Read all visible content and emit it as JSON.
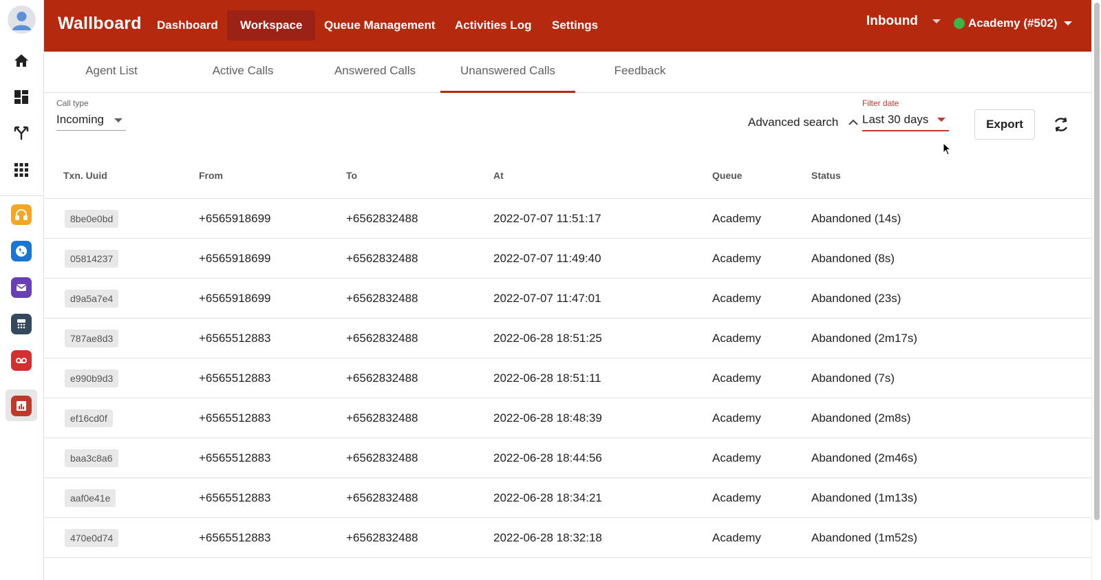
{
  "app": {
    "brand": "Wallboard"
  },
  "nav": [
    {
      "label": "Dashboard"
    },
    {
      "label": "Workspace"
    },
    {
      "label": "Queue Management"
    },
    {
      "label": "Activities Log"
    },
    {
      "label": "Settings"
    }
  ],
  "header": {
    "mode": "Inbound",
    "account": "Academy (#502)",
    "account_status_color": "#3bb54a"
  },
  "tabs": [
    {
      "label": "Agent List"
    },
    {
      "label": "Active Calls"
    },
    {
      "label": "Answered Calls"
    },
    {
      "label": "Unanswered Calls"
    },
    {
      "label": "Feedback"
    }
  ],
  "filters": {
    "call_type_label": "Call type",
    "call_type_value": "Incoming",
    "advanced_search": "Advanced search",
    "filter_date_label": "Filter date",
    "filter_date_value": "Last 30 days",
    "export_label": "Export"
  },
  "table": {
    "headers": [
      "Txn. Uuid",
      "From",
      "To",
      "At",
      "Queue",
      "Status"
    ],
    "rows": [
      [
        "8be0e0bd",
        "+6565918699",
        "+6562832488",
        "2022-07-07 11:51:17",
        "Academy",
        "Abandoned (14s)"
      ],
      [
        "05814237",
        "+6565918699",
        "+6562832488",
        "2022-07-07 11:49:40",
        "Academy",
        "Abandoned (8s)"
      ],
      [
        "d9a5a7e4",
        "+6565918699",
        "+6562832488",
        "2022-07-07 11:47:01",
        "Academy",
        "Abandoned (23s)"
      ],
      [
        "787ae8d3",
        "+6565512883",
        "+6562832488",
        "2022-06-28 18:51:25",
        "Academy",
        "Abandoned (2m17s)"
      ],
      [
        "e990b9d3",
        "+6565512883",
        "+6562832488",
        "2022-06-28 18:51:11",
        "Academy",
        "Abandoned (7s)"
      ],
      [
        "ef16cd0f",
        "+6565512883",
        "+6562832488",
        "2022-06-28 18:48:39",
        "Academy",
        "Abandoned (2m8s)"
      ],
      [
        "baa3c8a6",
        "+6565512883",
        "+6562832488",
        "2022-06-28 18:44:56",
        "Academy",
        "Abandoned (2m46s)"
      ],
      [
        "aaf0e41e",
        "+6565512883",
        "+6562832488",
        "2022-06-28 18:34:21",
        "Academy",
        "Abandoned (1m13s)"
      ],
      [
        "470e0d74",
        "+6565512883",
        "+6562832488",
        "2022-06-28 18:32:18",
        "Academy",
        "Abandoned (1m52s)"
      ]
    ]
  },
  "colors": {
    "brand": "#b5290f",
    "nav_active": "#9c2215"
  }
}
